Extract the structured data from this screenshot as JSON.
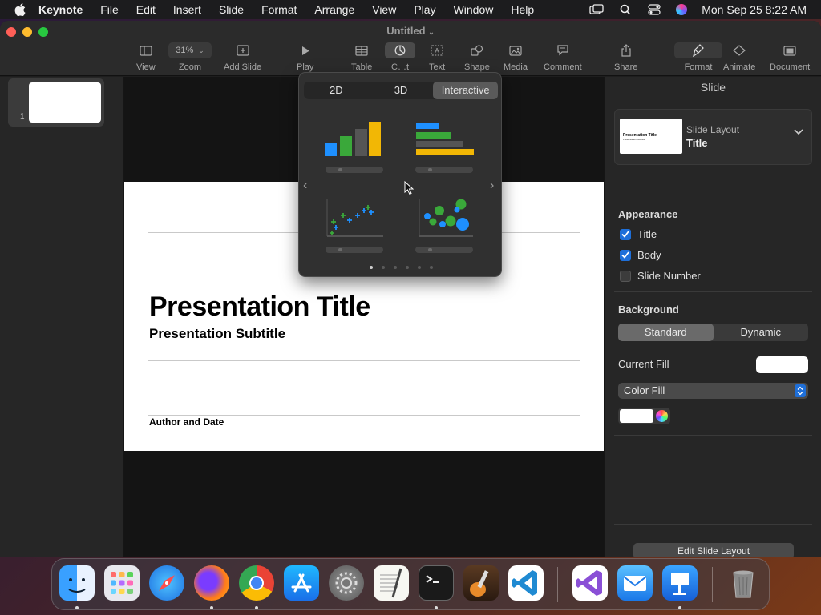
{
  "menubar": {
    "app": "Keynote",
    "items": [
      "File",
      "Edit",
      "Insert",
      "Slide",
      "Format",
      "Arrange",
      "View",
      "Play",
      "Window",
      "Help"
    ],
    "clock": "Mon Sep 25  8:22 AM"
  },
  "window": {
    "title": "Untitled",
    "toolbar": {
      "view": "View",
      "zoom_value": "31%",
      "zoom": "Zoom",
      "add_slide": "Add Slide",
      "play": "Play",
      "table": "Table",
      "chart": "C…t",
      "text": "Text",
      "shape": "Shape",
      "media": "Media",
      "comment": "Comment",
      "share": "Share",
      "format": "Format",
      "animate": "Animate",
      "document": "Document"
    }
  },
  "navigator": {
    "slide_number": "1"
  },
  "slide": {
    "title": "Presentation Title",
    "subtitle": "Presentation Subtitle",
    "author": "Author and Date"
  },
  "chart_popover": {
    "tabs": [
      "2D",
      "3D",
      "Interactive"
    ],
    "selected_tab": "Interactive",
    "page_count": 6,
    "current_page": 1
  },
  "inspector": {
    "header": "Slide",
    "layout_label": "Slide Layout",
    "layout_value": "Title",
    "layout_thumb_title": "Presentation Title",
    "layout_thumb_sub": "Presentation Subtitle",
    "appearance_title": "Appearance",
    "appearance": [
      {
        "label": "Title",
        "checked": true
      },
      {
        "label": "Body",
        "checked": true
      },
      {
        "label": "Slide Number",
        "checked": false
      }
    ],
    "background_title": "Background",
    "background_modes": [
      "Standard",
      "Dynamic"
    ],
    "background_selected": "Standard",
    "current_fill_label": "Current Fill",
    "fill_type": "Color Fill",
    "edit_layout": "Edit Slide Layout"
  },
  "colors": {
    "accent": "#1e6fd9",
    "chart_blue": "#1e90ff",
    "chart_green": "#3aa83a",
    "chart_gray": "#555555",
    "chart_yellow": "#f2b705"
  },
  "dock": {
    "apps": [
      "finder-icon",
      "launchpad-icon",
      "safari-icon",
      "firefox-icon",
      "chrome-icon",
      "app-store-icon",
      "system-settings-icon",
      "textedit-icon",
      "terminal-icon",
      "garageband-icon",
      "vscode-icon",
      "visual-studio-icon",
      "mail-icon",
      "keynote-icon",
      "trash-icon"
    ]
  }
}
